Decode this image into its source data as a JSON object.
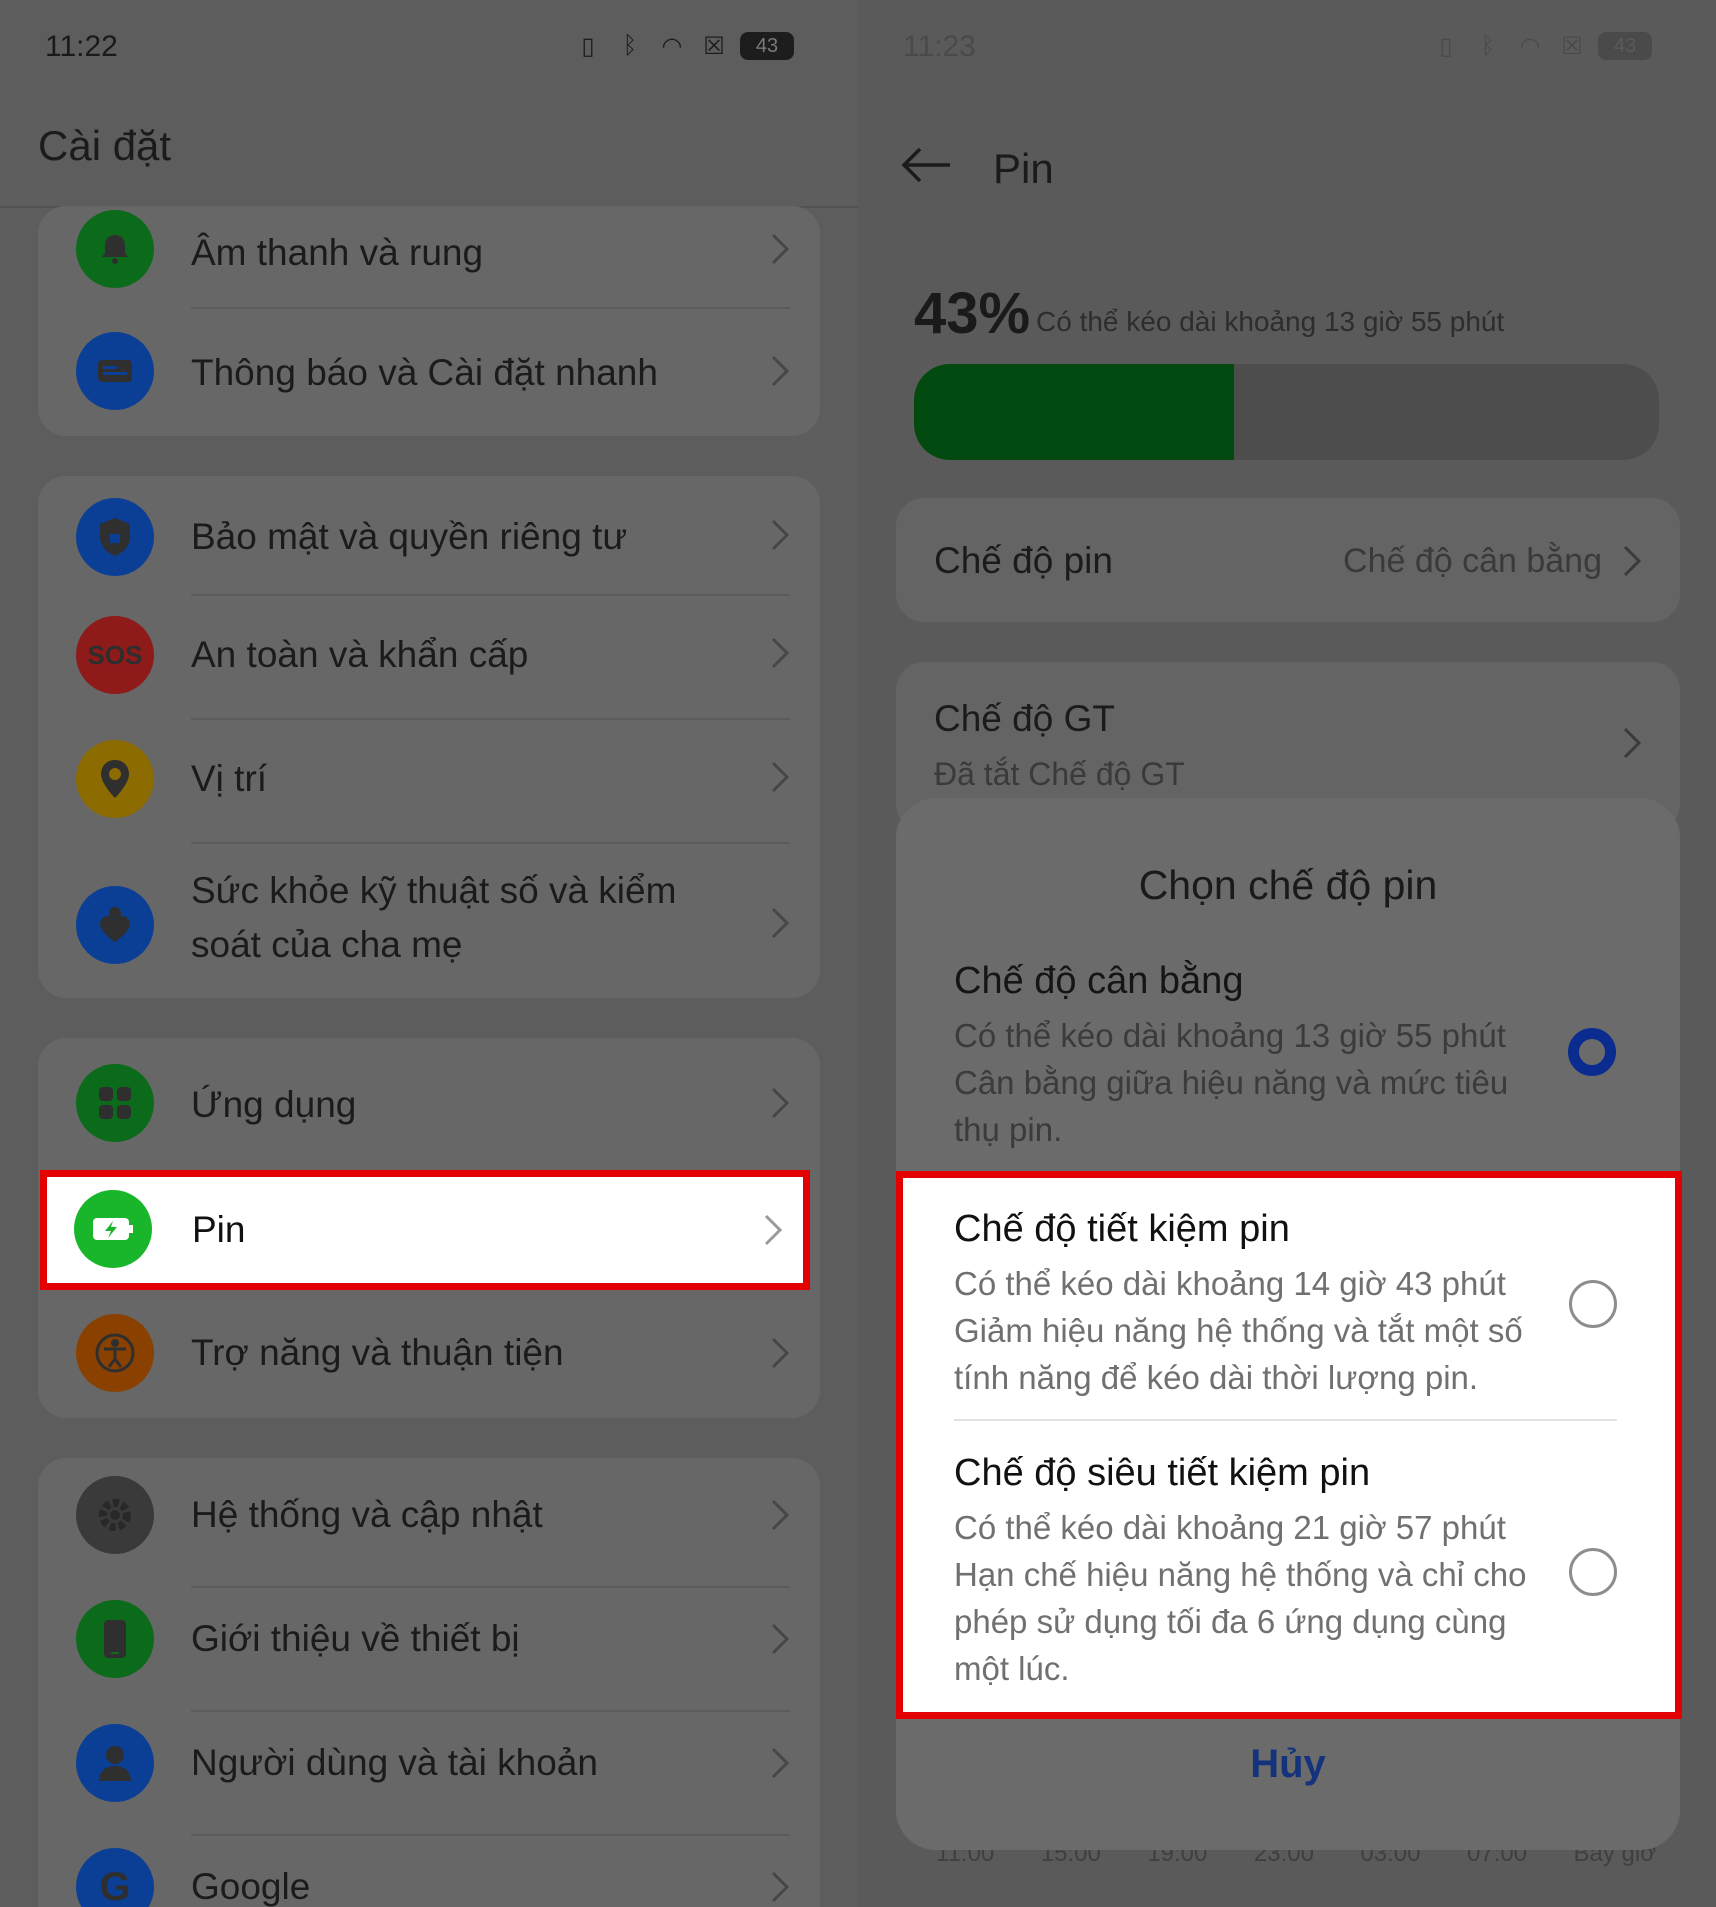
{
  "left": {
    "status_time": "11:22",
    "battery_level": "43",
    "title": "Cài đặt",
    "items": [
      {
        "label": "Âm thanh và rung",
        "icon": "bell-icon",
        "color": "#0b6b1a"
      },
      {
        "label": "Thông báo và Cài đặt nhanh",
        "icon": "notification-icon",
        "color": "#0b3f96"
      },
      {
        "label": "Bảo mật và quyền riêng tư",
        "icon": "shield-icon",
        "color": "#0b3f96"
      },
      {
        "label": "An toàn và khẩn cấp",
        "icon": "sos-icon",
        "color": "#8e1a1a"
      },
      {
        "label": "Vị trí",
        "icon": "location-icon",
        "color": "#8c6b00"
      },
      {
        "label": "Sức khỏe kỹ thuật số và kiểm soát của cha mẹ",
        "icon": "heart-person-icon",
        "color": "#0b3f96"
      },
      {
        "label": "Ứng dụng",
        "icon": "apps-icon",
        "color": "#0b6b1a"
      },
      {
        "label": "Pin",
        "icon": "battery-icon",
        "color": "#19b52b"
      },
      {
        "label": "Trợ năng và thuận tiện",
        "icon": "accessibility-icon",
        "color": "#8a4100"
      },
      {
        "label": "Hệ thống và cập nhật",
        "icon": "gear-icon",
        "color": "#3a3a3a"
      },
      {
        "label": "Giới thiệu về thiết bị",
        "icon": "phone-icon",
        "color": "#0b6b1a"
      },
      {
        "label": "Người dùng và tài khoản",
        "icon": "user-icon",
        "color": "#0b3f96"
      },
      {
        "label": "Google",
        "icon": "google-icon",
        "color": "#0b3f96"
      }
    ]
  },
  "right": {
    "status_time": "11:23",
    "battery_level": "43",
    "title": "Pin",
    "percent": "43%",
    "percent_fraction": 0.43,
    "estimate": "Có thể kéo dài khoảng 13 giờ 55 phút",
    "battery_mode_label": "Chế độ pin",
    "battery_mode_value": "Chế độ cân bằng",
    "gt_label": "Chế độ GT",
    "gt_sub": "Đã tắt Chế độ GT",
    "x_axis": [
      "11:00",
      "15:00",
      "19:00",
      "23:00",
      "03:00",
      "07:00",
      "Bây giờ"
    ],
    "sheet": {
      "title": "Chọn chế độ pin",
      "options": [
        {
          "title": "Chế độ cân bằng",
          "desc": "Có thể kéo dài khoảng 13 giờ 55 phút Cân bằng giữa hiệu năng và mức tiêu thụ pin.",
          "selected": true
        },
        {
          "title": "Chế độ tiết kiệm pin",
          "desc": "Có thể kéo dài khoảng 14 giờ 43 phút Giảm hiệu năng hệ thống và tắt một số tính năng để kéo dài thời lượng pin.",
          "selected": false
        },
        {
          "title": "Chế độ siêu tiết kiệm pin",
          "desc": "Có thể kéo dài khoảng 21 giờ 57 phút Hạn chế hiệu năng hệ thống và chỉ cho phép sử dụng tối đa 6 ứng dụng cùng một lúc.",
          "selected": false
        }
      ],
      "cancel": "Hủy"
    }
  },
  "colors": {
    "highlight": "#e20000",
    "accent": "#0b2c8f",
    "battery_fill": "#024a0f"
  }
}
